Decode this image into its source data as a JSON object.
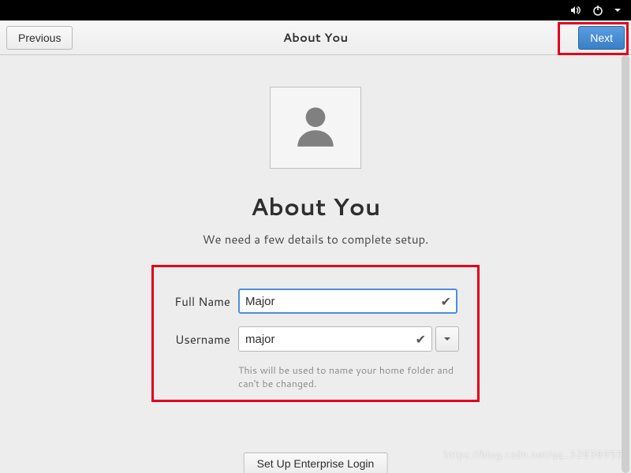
{
  "topbar": {
    "icons": [
      "volume-icon",
      "power-icon",
      "dropdown-arrow-icon"
    ]
  },
  "header": {
    "title": "About You",
    "previous_label": "Previous",
    "next_label": "Next"
  },
  "main": {
    "heading": "About You",
    "subtitle": "We need a few details to complete setup.",
    "fields": {
      "full_name": {
        "label": "Full Name",
        "value": "Major",
        "valid": true
      },
      "username": {
        "label": "Username",
        "value": "major",
        "valid": true,
        "hint": "This will be used to name your home folder and can't be changed."
      }
    },
    "enterprise_label": "Set Up Enterprise Login"
  },
  "watermark": "https://blog.csdn.net/qq_32838955"
}
